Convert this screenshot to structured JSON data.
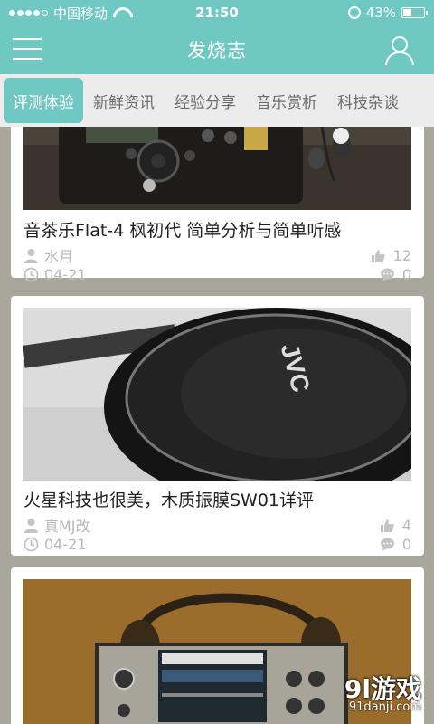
{
  "status": {
    "carrier": "中国移动",
    "time": "21:50",
    "battery": "43%",
    "battery_level": 0.43
  },
  "header": {
    "title": "发烧志",
    "menu_icon": "menu-icon",
    "user_icon": "user-icon"
  },
  "tabs": [
    {
      "label": "评测体验",
      "active": true
    },
    {
      "label": "新鲜资讯",
      "active": false
    },
    {
      "label": "经验分享",
      "active": false
    },
    {
      "label": "音乐赏析",
      "active": false
    },
    {
      "label": "科技杂谈",
      "active": false
    }
  ],
  "articles": [
    {
      "title": "音茶乐Flat-4 枫初代 简单分析与简单听感",
      "author": "水月",
      "date": "04-21",
      "likes": "12",
      "comments": "0",
      "image": "audio-recorder-with-earphones-photo"
    },
    {
      "title": "火星科技也很美，木质振膜SW01详评",
      "author": "真MJ改",
      "date": "04-21",
      "likes": "4",
      "comments": "0",
      "image": "jvc-headphones-photo"
    },
    {
      "title": "",
      "author": "",
      "date": "",
      "likes": "",
      "comments": "",
      "image": "headphone-amp-with-headphones-photo"
    }
  ],
  "watermark": {
    "brand": "9l游戏",
    "url": "91danji.com"
  },
  "colors": {
    "accent": "#6fc8c2",
    "background": "#a9a69b",
    "meta_text": "#b8b8b8"
  }
}
